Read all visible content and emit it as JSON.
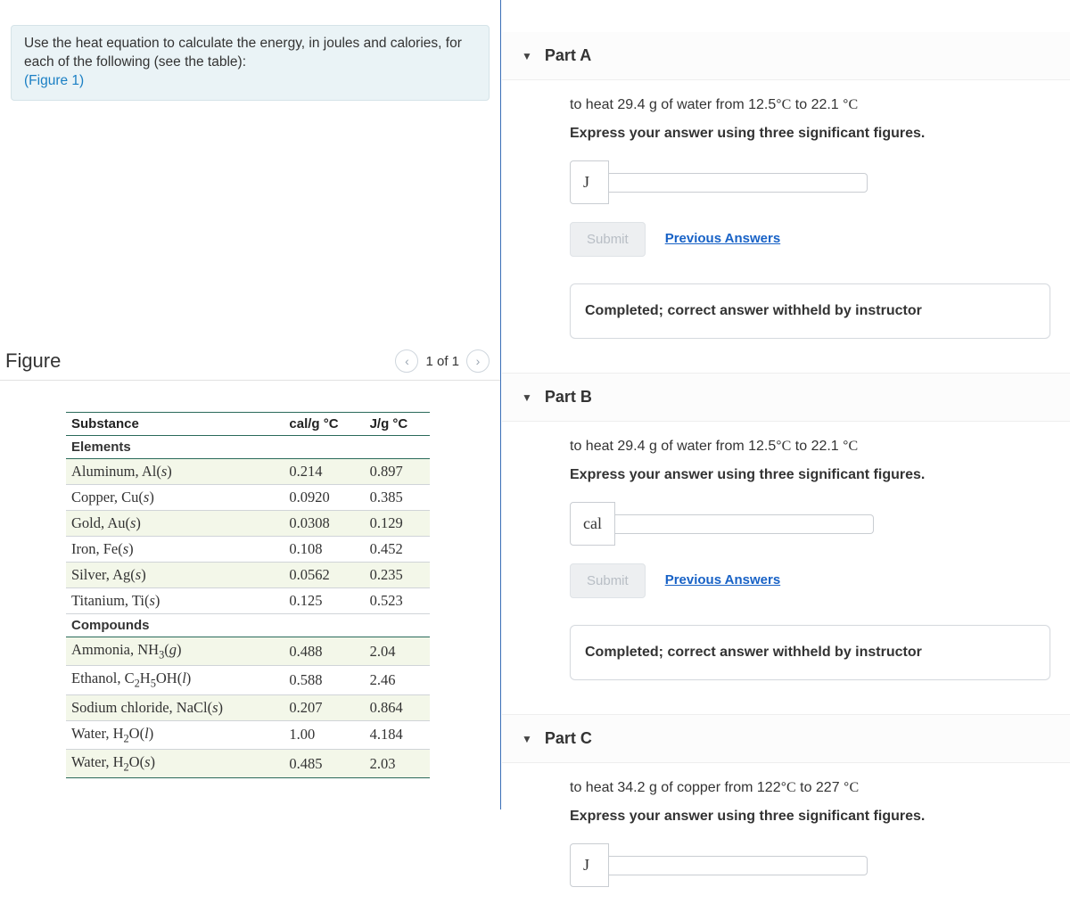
{
  "prompt": {
    "text1": "Use the heat equation to calculate the energy, in joules and calories, for each of the following (see the table):",
    "figlink": "(Figure 1)"
  },
  "figure": {
    "title": "Figure",
    "pager": "1 of 1",
    "table": {
      "headers": {
        "sub": "Substance",
        "cal": "cal/g °C",
        "j": "J/g °C"
      },
      "section_elements": "Elements",
      "elements": [
        {
          "name": "Aluminum, Al",
          "state": "s",
          "cal": "0.214",
          "j": "0.897",
          "alt": true
        },
        {
          "name": "Copper, Cu",
          "state": "s",
          "cal": "0.0920",
          "j": "0.385",
          "alt": false
        },
        {
          "name": "Gold, Au",
          "state": "s",
          "cal": "0.0308",
          "j": "0.129",
          "alt": true
        },
        {
          "name": "Iron, Fe",
          "state": "s",
          "cal": "0.108",
          "j": "0.452",
          "alt": false
        },
        {
          "name": "Silver, Ag",
          "state": "s",
          "cal": "0.0562",
          "j": "0.235",
          "alt": true
        },
        {
          "name": "Titanium, Ti",
          "state": "s",
          "cal": "0.125",
          "j": "0.523",
          "alt": false
        }
      ],
      "section_compounds": "Compounds",
      "compounds": [
        {
          "html": "Ammonia, NH<sub>3</sub>(<span class='state'>g</span>)",
          "cal": "0.488",
          "j": "2.04",
          "alt": true
        },
        {
          "html": "Ethanol, C<sub>2</sub>H<sub>5</sub>OH(<span class='state'>l</span>)",
          "cal": "0.588",
          "j": "2.46",
          "alt": false
        },
        {
          "html": "Sodium chloride, NaCl(<span class='state'>s</span>)",
          "cal": "0.207",
          "j": "0.864",
          "alt": true
        },
        {
          "html": "Water, H<sub>2</sub>O(<span class='state'>l</span>)",
          "cal": "1.00",
          "j": "4.184",
          "alt": false
        },
        {
          "html": "Water, H<sub>2</sub>O(<span class='state'>s</span>)",
          "cal": "0.485",
          "j": "2.03",
          "alt": true
        }
      ]
    }
  },
  "partA": {
    "title": "Part A",
    "q_html": "to heat 29.4 g of water from 12.5°<span class='deg'>C</span> to 22.1 °<span class='deg'>C</span>",
    "instr": "Express your answer using three significant figures.",
    "unit": "J",
    "submit": "Submit",
    "prev": "Previous Answers",
    "status": "Completed; correct answer withheld by instructor"
  },
  "partB": {
    "title": "Part B",
    "q_html": "to heat 29.4 g of water from 12.5°<span class='deg'>C</span> to 22.1 °<span class='deg'>C</span>",
    "instr": "Express your answer using three significant figures.",
    "unit": "cal",
    "submit": "Submit",
    "prev": "Previous Answers",
    "status": "Completed; correct answer withheld by instructor"
  },
  "partC": {
    "title": "Part C",
    "q_html": "to heat 34.2 g of copper from 122°<span class='deg'>C</span> to 227 °<span class='deg'>C</span>",
    "instr": "Express your answer using three significant figures.",
    "unit": "J"
  },
  "chart_data": {
    "type": "table",
    "title": "Specific heat capacities of substances",
    "columns": [
      "Substance",
      "cal/g °C",
      "J/g °C"
    ],
    "rows": [
      [
        "Aluminum, Al(s)",
        0.214,
        0.897
      ],
      [
        "Copper, Cu(s)",
        0.092,
        0.385
      ],
      [
        "Gold, Au(s)",
        0.0308,
        0.129
      ],
      [
        "Iron, Fe(s)",
        0.108,
        0.452
      ],
      [
        "Silver, Ag(s)",
        0.0562,
        0.235
      ],
      [
        "Titanium, Ti(s)",
        0.125,
        0.523
      ],
      [
        "Ammonia, NH3(g)",
        0.488,
        2.04
      ],
      [
        "Ethanol, C2H5OH(l)",
        0.588,
        2.46
      ],
      [
        "Sodium chloride, NaCl(s)",
        0.207,
        0.864
      ],
      [
        "Water, H2O(l)",
        1.0,
        4.184
      ],
      [
        "Water, H2O(s)",
        0.485,
        2.03
      ]
    ]
  }
}
